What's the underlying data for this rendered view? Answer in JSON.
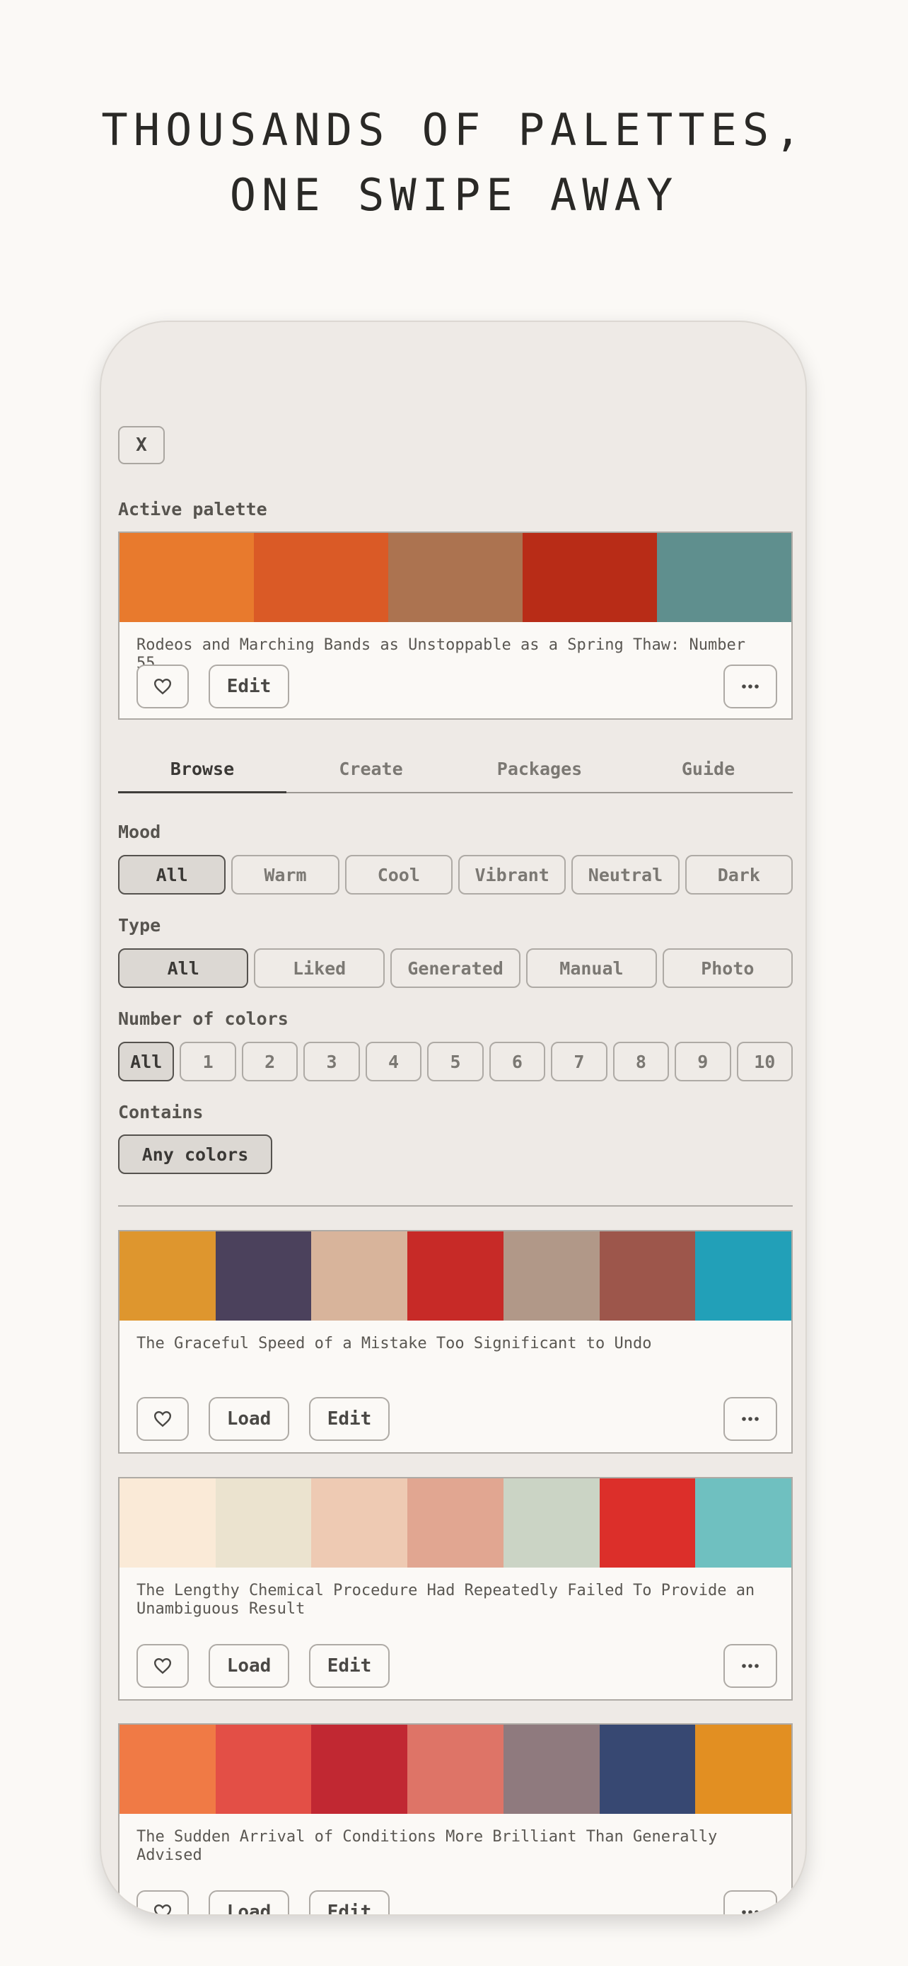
{
  "headline": {
    "line1": "THOUSANDS OF PALETTES,",
    "line2": "ONE SWIPE AWAY"
  },
  "close_label": "X",
  "active_palette": {
    "label": "Active palette",
    "colors": [
      "#E87A2D",
      "#DA5A26",
      "#AC7350",
      "#B82C17",
      "#5F8F8E"
    ],
    "name": "Rodeos and Marching Bands as Unstoppable as a Spring Thaw: Number 55",
    "edit_label": "Edit",
    "like_icon": "heart-icon",
    "more_icon": "more-dots-icon"
  },
  "tabs": [
    {
      "label": "Browse",
      "active": true
    },
    {
      "label": "Create",
      "active": false
    },
    {
      "label": "Packages",
      "active": false
    },
    {
      "label": "Guide",
      "active": false
    }
  ],
  "filters": {
    "mood": {
      "label": "Mood",
      "options": [
        "All",
        "Warm",
        "Cool",
        "Vibrant",
        "Neutral",
        "Dark"
      ],
      "selected": "All"
    },
    "type": {
      "label": "Type",
      "options": [
        "All",
        "Liked",
        "Generated",
        "Manual",
        "Photo"
      ],
      "selected": "All"
    },
    "count": {
      "label": "Number of colors",
      "options": [
        "All",
        "1",
        "2",
        "3",
        "4",
        "5",
        "6",
        "7",
        "8",
        "9",
        "10"
      ],
      "selected": "All"
    },
    "contains": {
      "label": "Contains",
      "value": "Any colors"
    }
  },
  "palettes": [
    {
      "name": "The Graceful Speed of a Mistake Too Significant to Undo",
      "colors": [
        "#DE962E",
        "#4B415C",
        "#D8B49B",
        "#C72A27",
        "#B19888",
        "#9D564B",
        "#22A0B8"
      ]
    },
    {
      "name": "The Lengthy Chemical Procedure Had Repeatedly Failed To Provide an Unambiguous Result",
      "colors": [
        "#FAEAD7",
        "#EBE3CF",
        "#EECAB3",
        "#E1A691",
        "#CBD4C5",
        "#DC2F2A",
        "#6FC0C0"
      ]
    },
    {
      "name": "The Sudden Arrival of Conditions More Brilliant Than Generally Advised",
      "colors": [
        "#F07A45",
        "#E34F46",
        "#C12832",
        "#DE7467",
        "#8F7A7E",
        "#374872",
        "#E28F22"
      ]
    }
  ],
  "buttons": {
    "load": "Load",
    "edit": "Edit"
  }
}
